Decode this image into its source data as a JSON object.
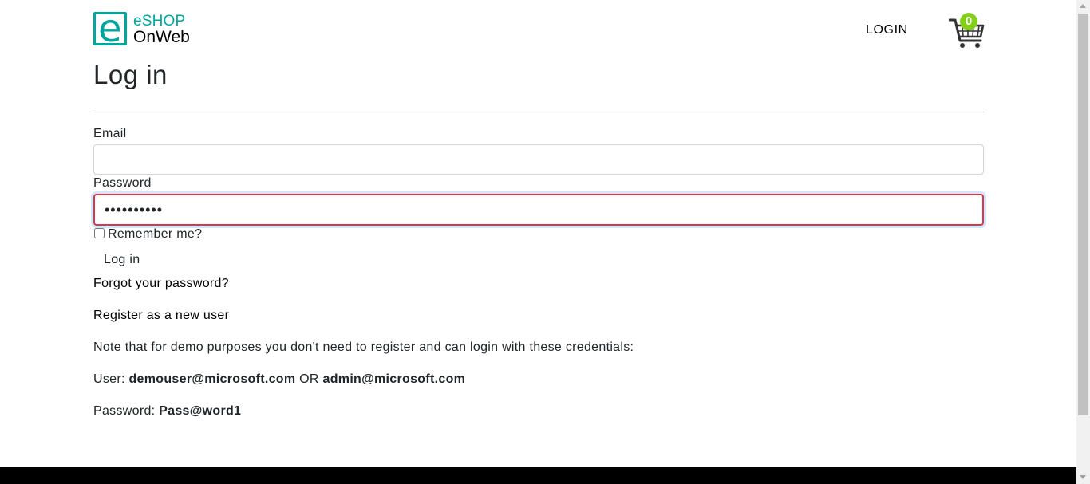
{
  "header": {
    "logo_line1": "eSHOP",
    "logo_line2": "OnWeb",
    "logo_letter": "e",
    "login_link": "LOGIN",
    "cart_count": "0",
    "cart_icon": "shopping-cart-icon"
  },
  "page": {
    "title": "Log in"
  },
  "form": {
    "email_label": "Email",
    "email_value": "",
    "password_label": "Password",
    "password_value": "••••••••••",
    "remember_label": "Remember me?",
    "remember_checked": false,
    "submit_label": "Log in"
  },
  "links": {
    "forgot": "Forgot your password?",
    "register": "Register as a new user"
  },
  "notes": {
    "line1": "Note that for demo purposes you don't need to register and can login with these credentials:",
    "user_prefix": "User:",
    "user1": "demouser@microsoft.com",
    "or": "OR",
    "user2": "admin@microsoft.com",
    "password_prefix": "Password:",
    "password": "Pass@word1"
  },
  "colors": {
    "brand": "#00a69c",
    "badge": "#83d01b",
    "invalid_border": "#dc3545",
    "footer": "#000000"
  }
}
